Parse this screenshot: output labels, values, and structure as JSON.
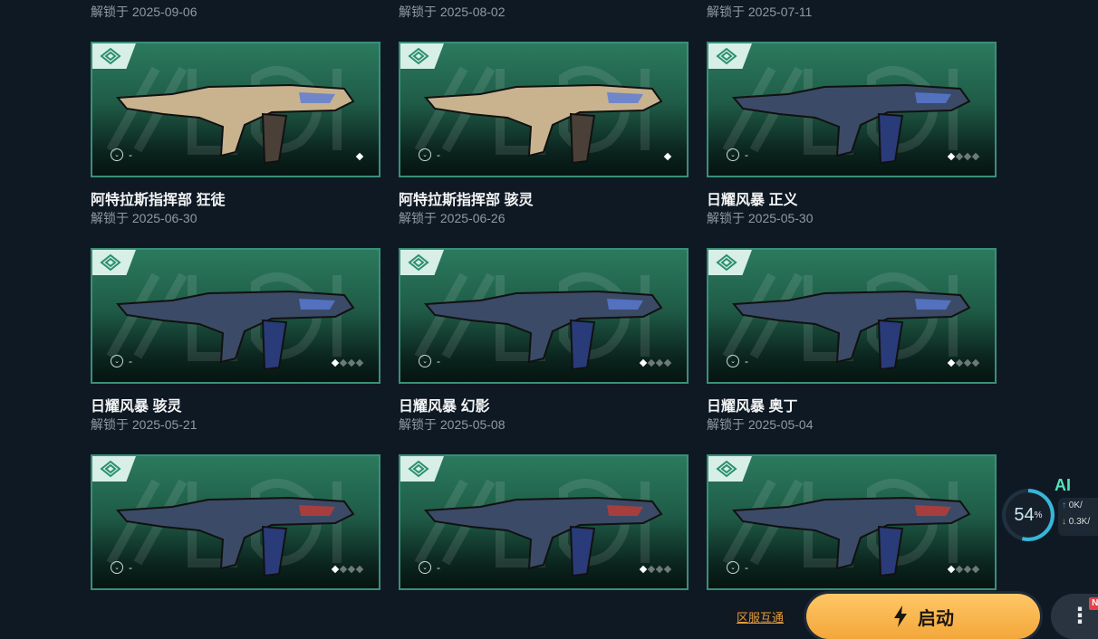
{
  "top_dates": [
    "解锁于 2025-09-06",
    "解锁于 2025-08-02",
    "解锁于 2025-07-11"
  ],
  "rows": [
    [
      {
        "name": "阿特拉斯指挥部 狂徒",
        "date": "解锁于 2025-06-30",
        "level": "-",
        "pips_total": 1,
        "pips_on": 1
      },
      {
        "name": "阿特拉斯指挥部 骇灵",
        "date": "解锁于 2025-06-26",
        "level": "-",
        "pips_total": 1,
        "pips_on": 1
      },
      {
        "name": "日耀风暴 正义",
        "date": "解锁于 2025-05-30",
        "level": "-",
        "pips_total": 4,
        "pips_on": 1
      }
    ],
    [
      {
        "name": "日耀风暴 骇灵",
        "date": "解锁于 2025-05-21",
        "level": "-",
        "pips_total": 4,
        "pips_on": 1
      },
      {
        "name": "日耀风暴 幻影",
        "date": "解锁于 2025-05-08",
        "level": "-",
        "pips_total": 4,
        "pips_on": 1
      },
      {
        "name": "日耀风暴 奥丁",
        "date": "解锁于 2025-05-04",
        "level": "-",
        "pips_total": 4,
        "pips_on": 1
      }
    ],
    [
      {
        "name": "",
        "date": "",
        "level": "-",
        "pips_total": 4,
        "pips_on": 1
      },
      {
        "name": "",
        "date": "",
        "level": "-",
        "pips_total": 4,
        "pips_on": 1
      },
      {
        "name": "",
        "date": "",
        "level": "-",
        "pips_total": 4,
        "pips_on": 1
      }
    ]
  ],
  "widget": {
    "ai_label": "AI",
    "percent": "54",
    "percent_unit": "%",
    "upload": "0K/",
    "download": "0.3K/"
  },
  "bottom": {
    "region_label": "区服互通",
    "launch_label": "启动",
    "more_label": "⋮",
    "new_badge": "NE"
  },
  "colors": {
    "card_bg": "#2b7a5e",
    "accent": "#f3a73a",
    "page_bg": "#0f1923"
  }
}
